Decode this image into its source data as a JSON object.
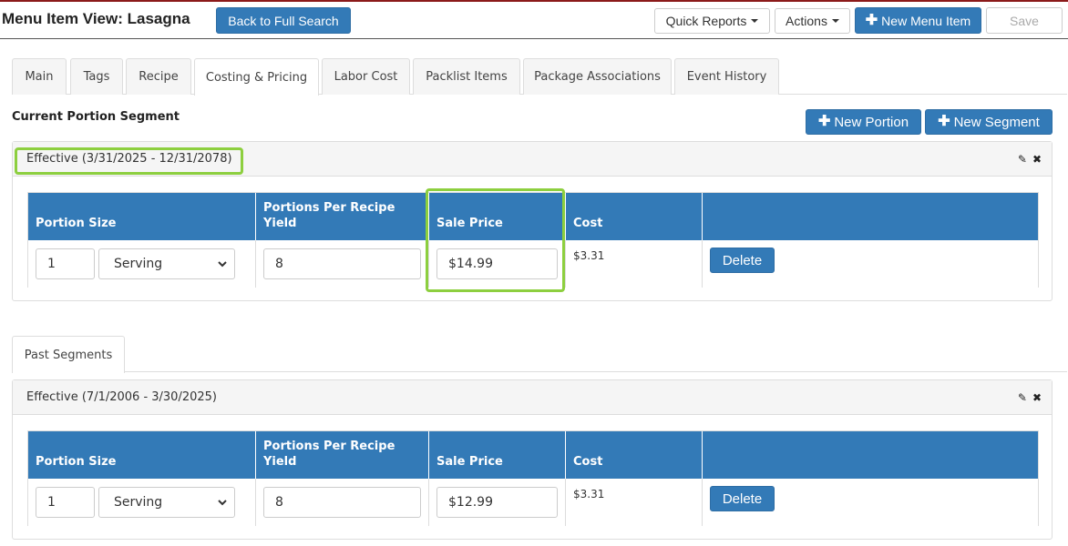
{
  "header": {
    "title": "Menu Item View: Lasagna",
    "back_label": "Back to Full Search",
    "quick_reports_label": "Quick Reports",
    "actions_label": "Actions",
    "new_menu_item_label": "New Menu Item",
    "save_label": "Save"
  },
  "tabs": [
    {
      "label": "Main"
    },
    {
      "label": "Tags"
    },
    {
      "label": "Recipe"
    },
    {
      "label": "Costing & Pricing",
      "active": true
    },
    {
      "label": "Labor Cost"
    },
    {
      "label": "Packlist Items"
    },
    {
      "label": "Package Associations"
    },
    {
      "label": "Event History"
    }
  ],
  "current_segment": {
    "title": "Current Portion Segment",
    "new_portion_label": "New Portion",
    "new_segment_label": "New Segment",
    "effective": "Effective (3/31/2025 - 12/31/2078)",
    "columns": [
      "Portion Size",
      "Portions Per Recipe Yield",
      "Sale Price",
      "Cost",
      ""
    ],
    "row": {
      "portion_qty": "1",
      "portion_unit": "Serving",
      "portions_per_yield": "8",
      "sale_price": "$14.99",
      "cost": "$3.31",
      "delete_label": "Delete"
    }
  },
  "past_segments": {
    "tab_label": "Past Segments",
    "effective": "Effective (7/1/2006 - 3/30/2025)",
    "columns": [
      "Portion Size",
      "Portions Per Recipe Yield",
      "Sale Price",
      "Cost",
      ""
    ],
    "row": {
      "portion_qty": "1",
      "portion_unit": "Serving",
      "portions_per_yield": "8",
      "sale_price": "$12.99",
      "cost": "$3.31",
      "delete_label": "Delete"
    }
  },
  "colors": {
    "primary": "#337ab7",
    "highlight": "#8dcf3f",
    "top_accent": "#8b1a1a"
  },
  "icons": [
    "pencil-icon",
    "close-icon",
    "plus-icon",
    "caret-down-icon",
    "chevron-down-icon"
  ]
}
